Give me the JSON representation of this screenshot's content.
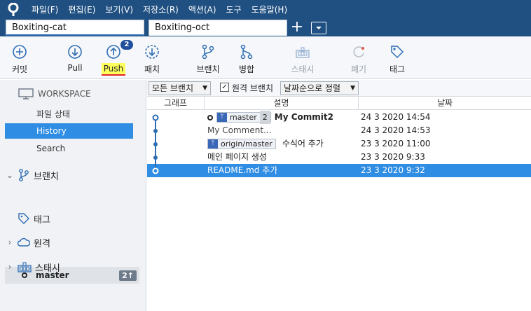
{
  "menu": [
    "파일(F)",
    "편집(E)",
    "보기(V)",
    "저장소(R)",
    "액션(A)",
    "도구",
    "도움말(H)"
  ],
  "tabs": {
    "active": "Boxiting-cat",
    "inactive": "Boxiting-oct",
    "add": "+"
  },
  "toolbar": {
    "commit": "커밋",
    "pull": "Pull",
    "push": "Push",
    "push_badge": "2",
    "fetch": "패치",
    "branch": "브랜치",
    "merge": "병합",
    "stash": "스태시",
    "discard": "폐기",
    "tag": "태그"
  },
  "sidebar": {
    "workspace": "WORKSPACE",
    "items": [
      "파일 상태",
      "History",
      "Search"
    ],
    "branches_label": "브랜치",
    "branch_name": "master",
    "branch_ahead": "2↑",
    "tags_label": "태그",
    "remotes_label": "원격",
    "stashes_label": "스태시"
  },
  "filter": {
    "branches": "모든 브랜치",
    "remote_branches": "원격 브랜치",
    "sort": "날짜순으로 정렬"
  },
  "columns": {
    "graph": "그래프",
    "description": "설명",
    "date": "날짜"
  },
  "commits": [
    {
      "ref": "master",
      "ref_count": "2",
      "message": "My Commit2",
      "date": "24 3 2020 14:54"
    },
    {
      "message": "My Comment...",
      "date": "24 3 2020 14:53"
    },
    {
      "ref": "origin/master",
      "message": "수식어 추가",
      "date": "23 3 2020 11:00"
    },
    {
      "message": "메인 페이지 생성",
      "date": "23 3 2020 9:33"
    },
    {
      "message": "README.md 추가",
      "date": "23 3 2020 9:32"
    }
  ],
  "colors": {
    "menubar": "#205081",
    "selection": "#2f8de4",
    "graph": "#2f6db3"
  }
}
